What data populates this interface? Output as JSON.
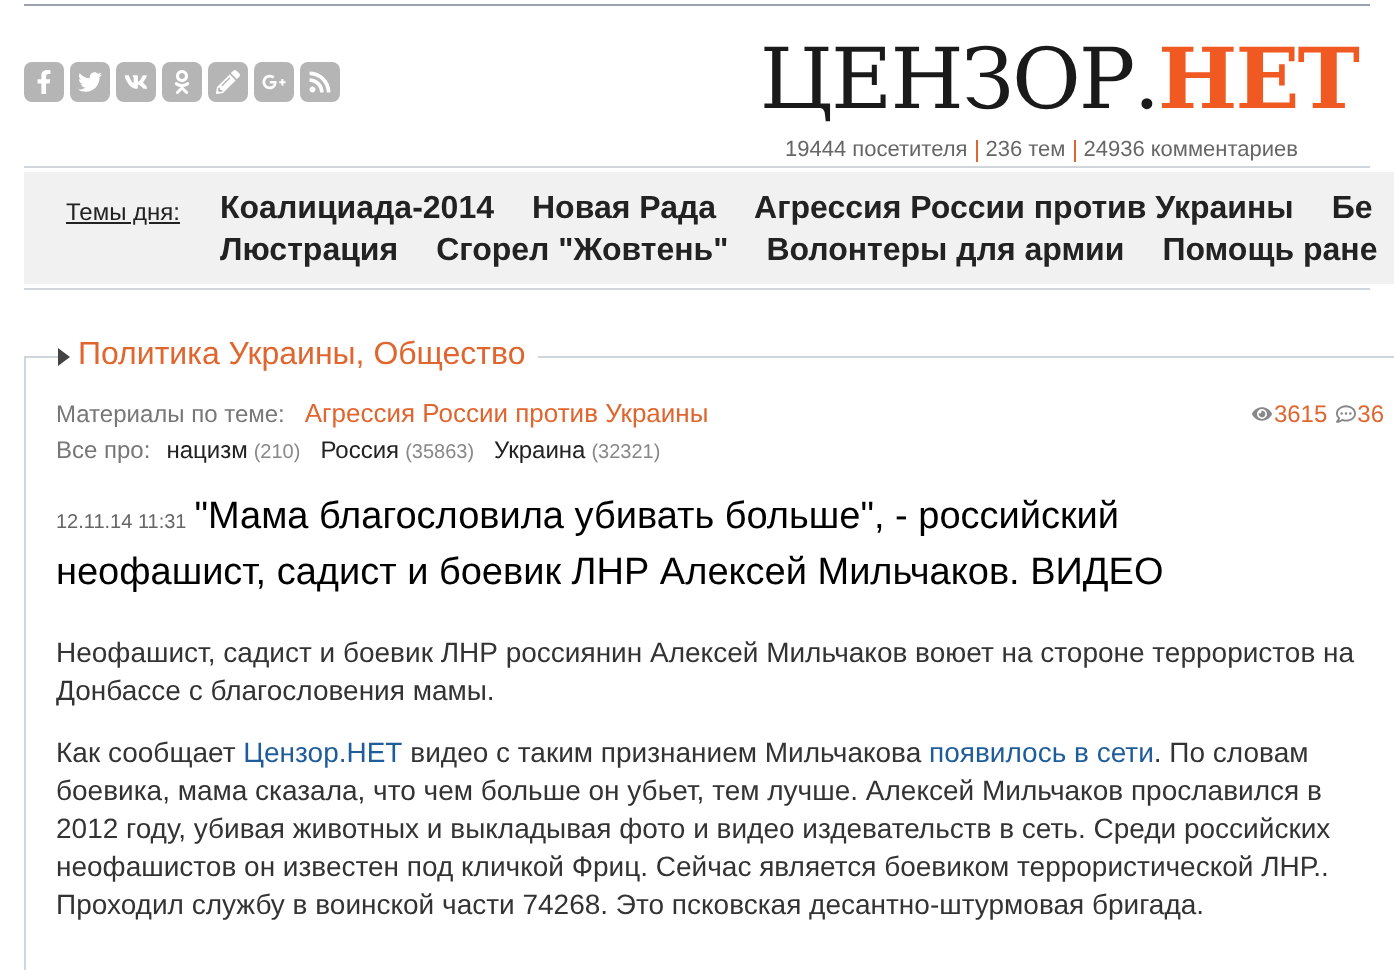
{
  "social_icons": [
    {
      "kind": "facebook"
    },
    {
      "kind": "twitter"
    },
    {
      "kind": "vk"
    },
    {
      "kind": "odnoklassniki"
    },
    {
      "kind": "pencil"
    },
    {
      "kind": "googleplus"
    },
    {
      "kind": "rss"
    }
  ],
  "logo": {
    "main": "ЦЕНЗОР",
    "dot": ".",
    "accent": "НЕТ"
  },
  "stats": [
    "19444 посетителя",
    "236 тем",
    "24936 комментариев"
  ],
  "topics": {
    "label": "Темы дня:",
    "rows": [
      [
        "Коалициада-2014",
        "Новая Рада",
        "Агрессия России против Украины",
        "Бе"
      ],
      [
        "Люстрация",
        "Сгорел \"Жовтень\"",
        "Волонтеры для армии",
        "Помощь ране"
      ]
    ]
  },
  "section": {
    "title": "Политика Украины, Общество"
  },
  "meta": {
    "materials_label": "Материалы по теме:",
    "materials_link": "Агрессия России против Украины",
    "views": "3615",
    "comments": "36",
    "tags_label": "Все про:",
    "tags": [
      {
        "name": "нацизм",
        "count": "(210)"
      },
      {
        "name": "Россия",
        "count": "(35863)"
      },
      {
        "name": "Украина",
        "count": "(32321)"
      }
    ]
  },
  "article": {
    "date": "12.11.14 11:31",
    "title": "\"Мама благословила убивать больше\", - российский неофашист, садист и боевик ЛНР Алексей Мильчаков. ВИДЕО",
    "lead": "Неофашист, садист и боевик ЛНР россиянин Алексей Мильчаков воюет на стороне террористов на Донбассе с благословения мамы.",
    "body": [
      {
        "kind": "text",
        "text": "Как сообщает "
      },
      {
        "kind": "link",
        "text": "Цензор.НЕТ"
      },
      {
        "kind": "text",
        "text": " видео с таким признанием Мильчакова "
      },
      {
        "kind": "link",
        "text": "появилось в сети"
      },
      {
        "kind": "text",
        "text": ". По словам боевика, мама сказала, что чем больше он убьет, тем лучше. Алексей Мильчаков прославился в 2012 году, убивая животных и выкладывая фото и видео издевательств в сеть. Среди российских неофашистов он известен под кличкой Фриц. Сейчас является боевиком террористической ЛНР.. Проходил службу в воинской части 74268. Это псковская десантно-штурмовая бригада."
      }
    ]
  }
}
